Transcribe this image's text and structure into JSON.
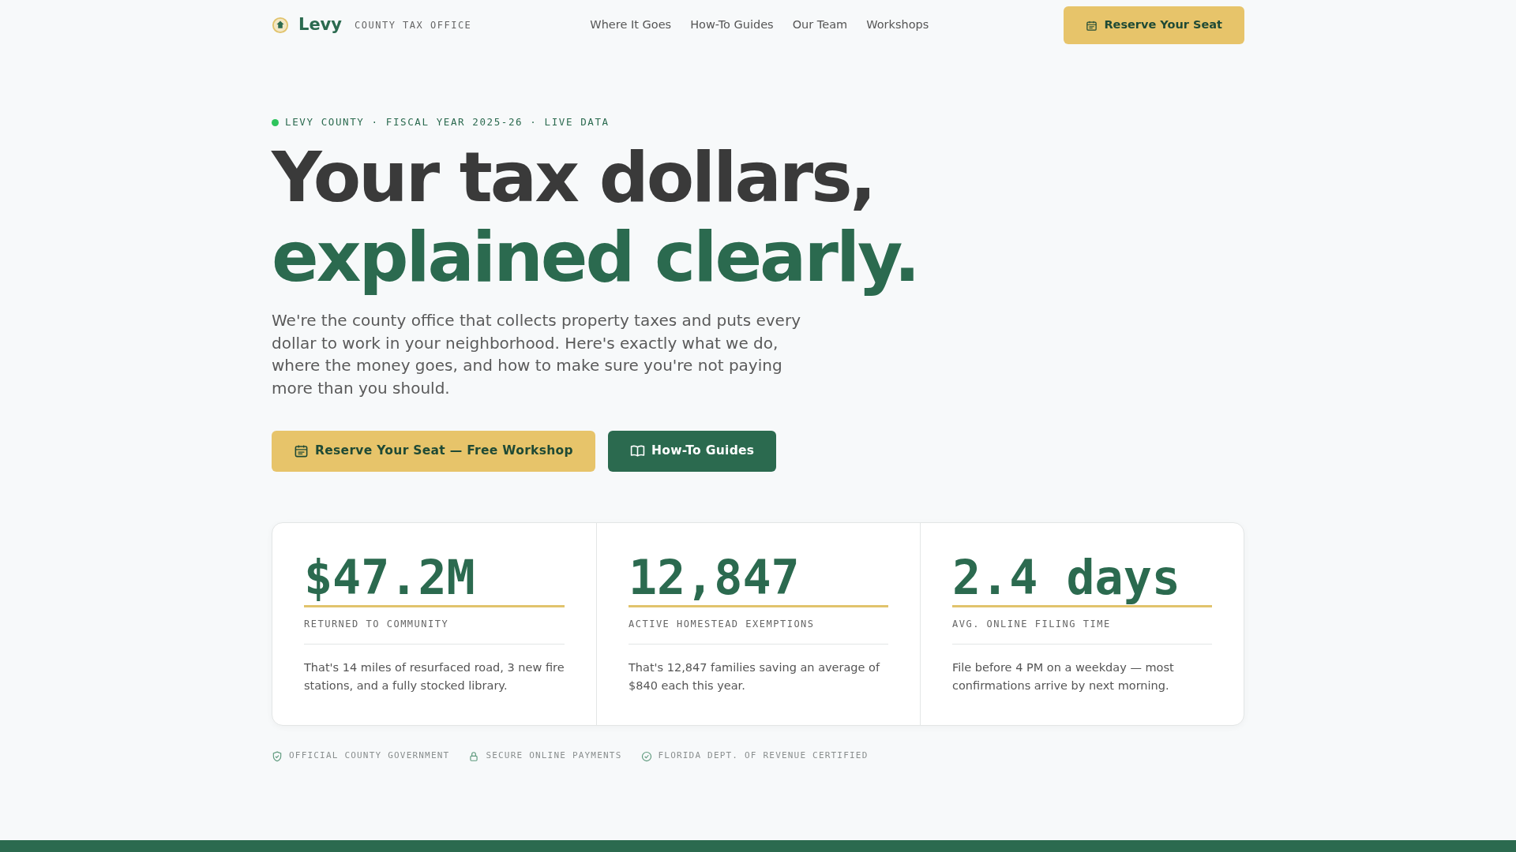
{
  "brand": {
    "name": "Levy",
    "tagline": "COUNTY TAX OFFICE"
  },
  "nav": {
    "links": [
      {
        "label": "Where It Goes"
      },
      {
        "label": "How-To Guides"
      },
      {
        "label": "Our Team"
      },
      {
        "label": "Workshops"
      }
    ],
    "cta": "Reserve Your Seat"
  },
  "hero": {
    "eyebrow": "LEVY COUNTY · FISCAL YEAR 2025-26 · LIVE DATA",
    "title_line_1": "Your tax dollars,",
    "title_line_2": "explained clearly.",
    "lead": "We're the county office that collects property taxes and puts every dollar to work in your neighborhood. Here's exactly what we do, where the money goes, and how to make sure you're not paying more than you should.",
    "buttons": [
      {
        "kind": "primary",
        "label": "Reserve Your Seat — Free Workshop"
      },
      {
        "kind": "secondary",
        "label": "How-To Guides"
      }
    ]
  },
  "stats": [
    {
      "value": "$47.2M",
      "label": "RETURNED TO COMMUNITY",
      "note": "That's 14 miles of resurfaced road, 3 new fire stations, and a fully stocked library."
    },
    {
      "value": "12,847",
      "label": "ACTIVE HOMESTEAD EXEMPTIONS",
      "note": "That's 12,847 families saving an average of $840 each this year."
    },
    {
      "value": "2.4 days",
      "label": "AVG. ONLINE FILING TIME",
      "note": "File before 4 PM on a weekday — most confirmations arrive by next morning."
    }
  ],
  "trust": [
    {
      "kind": "shield",
      "label": "OFFICIAL COUNTY GOVERNMENT"
    },
    {
      "kind": "lock",
      "label": "SECURE ONLINE PAYMENTS"
    },
    {
      "kind": "check",
      "label": "FLORIDA DEPT. OF REVENUE CERTIFIED"
    }
  ]
}
